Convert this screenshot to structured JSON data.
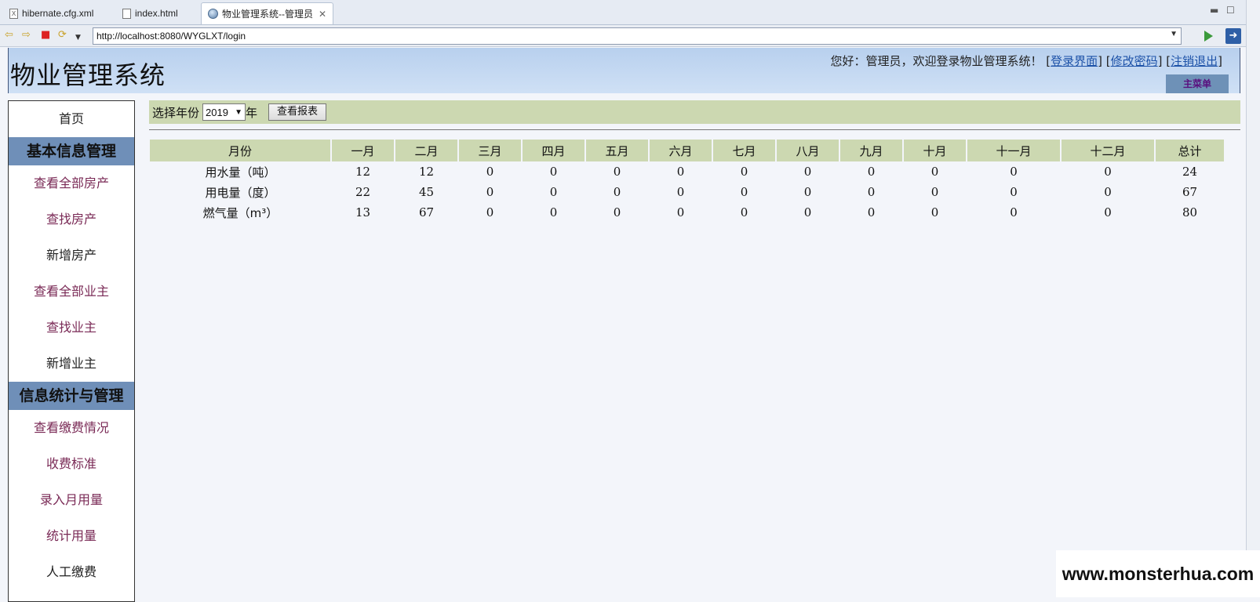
{
  "browser": {
    "tabs": [
      {
        "label": "hibernate.cfg.xml"
      },
      {
        "label": "index.html"
      },
      {
        "label": "物业管理系统--管理员"
      }
    ],
    "url": "http://localhost:8080/WYGLXT/login"
  },
  "header": {
    "title": "物业管理系统",
    "greeting": "您好：管理员，欢迎登录物业管理系统！",
    "links": [
      "登录界面",
      "修改密码",
      "注销退出"
    ],
    "main_menu": "主菜单"
  },
  "sidebar": {
    "home": "首页",
    "section1": "基本信息管理",
    "items1": [
      "查看全部房产",
      "查找房产",
      "新增房产",
      "查看全部业主",
      "查找业主",
      "新增业主"
    ],
    "section2": "信息统计与管理",
    "items2": [
      "查看缴费情况",
      "收费标准",
      "录入月用量",
      "统计用量",
      "人工缴费"
    ]
  },
  "filter": {
    "label": "选择年份",
    "year": "2019",
    "suffix": "年",
    "button": "查看报表"
  },
  "table": {
    "headers": [
      "月份",
      "一月",
      "二月",
      "三月",
      "四月",
      "五月",
      "六月",
      "七月",
      "八月",
      "九月",
      "十月",
      "十一月",
      "十二月",
      "总计"
    ],
    "rows": [
      [
        "用水量（吨）",
        "12",
        "12",
        "0",
        "0",
        "0",
        "0",
        "0",
        "0",
        "0",
        "0",
        "0",
        "0",
        "24"
      ],
      [
        "用电量（度）",
        "22",
        "45",
        "0",
        "0",
        "0",
        "0",
        "0",
        "0",
        "0",
        "0",
        "0",
        "0",
        "67"
      ],
      [
        "燃气量（m³）",
        "13",
        "67",
        "0",
        "0",
        "0",
        "0",
        "0",
        "0",
        "0",
        "0",
        "0",
        "0",
        "80"
      ]
    ]
  },
  "watermark": "www.monsterhua.com"
}
